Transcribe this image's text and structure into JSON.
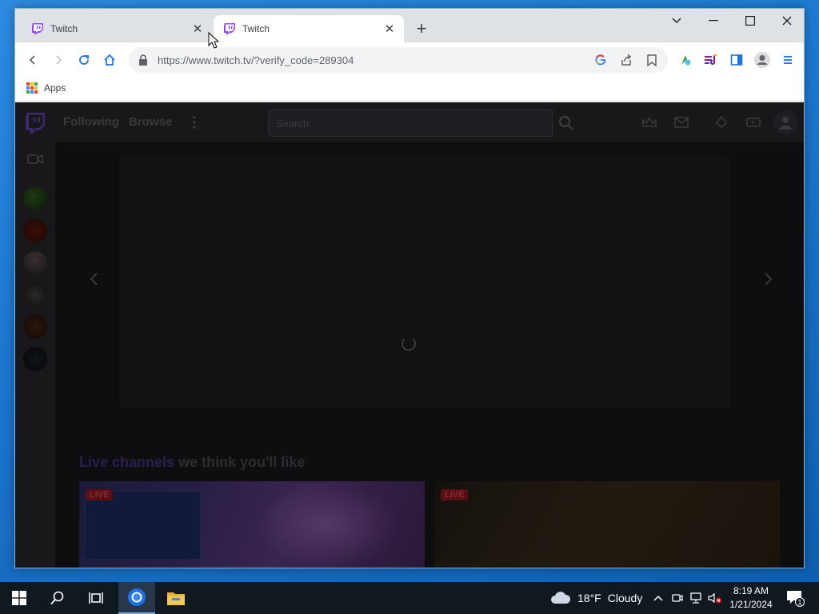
{
  "browser": {
    "tabs": [
      {
        "title": "Twitch",
        "active": false
      },
      {
        "title": "Twitch",
        "active": true
      }
    ],
    "address_bar": {
      "url": "https://www.twitch.tv/?verify_code=289304"
    },
    "bookmarks": [
      {
        "label": "Apps"
      }
    ]
  },
  "twitch": {
    "nav": {
      "following": "Following",
      "browse": "Browse"
    },
    "search": {
      "placeholder": "Search"
    },
    "section": {
      "accent": "Live channels",
      "rest": " we think you'll like"
    },
    "live_badge": "LIVE",
    "brand_color": "#9146ff"
  },
  "taskbar": {
    "weather": {
      "temp": "18°F",
      "condition": "Cloudy"
    },
    "clock": {
      "time": "8:19 AM",
      "date": "1/21/2024"
    },
    "notifications_count": "1"
  }
}
